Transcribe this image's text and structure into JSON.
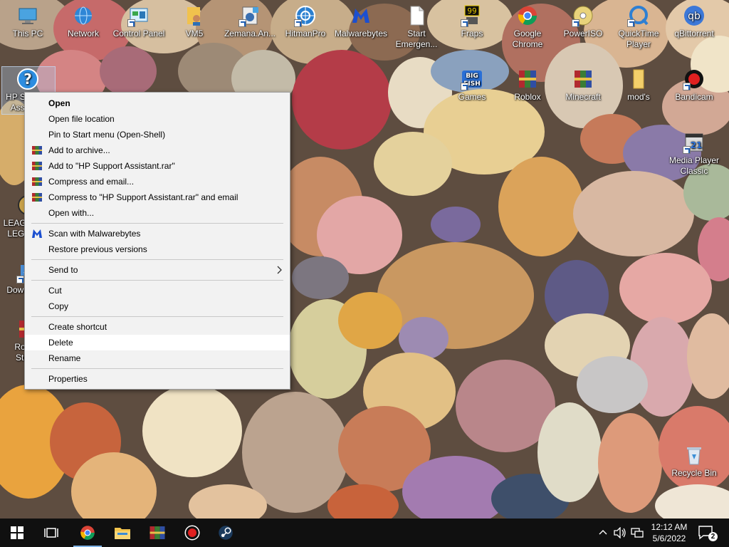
{
  "desktop": {
    "icons": [
      {
        "label": "This PC"
      },
      {
        "label": "Network"
      },
      {
        "label": "Control Panel"
      },
      {
        "label": "VM5"
      },
      {
        "label": "Zemana.An..."
      },
      {
        "label": "HitmanPro"
      },
      {
        "label": "Malwarebytes"
      },
      {
        "label": "Start Emergen..."
      },
      {
        "label": "Fraps"
      },
      {
        "label": "Google Chrome"
      },
      {
        "label": "PowerISO"
      },
      {
        "label": "QuickTime Player"
      },
      {
        "label": "qBittorrent"
      },
      {
        "label": "HP Support Assistant"
      },
      {
        "label": "Games"
      },
      {
        "label": "Roblox"
      },
      {
        "label": "Minecraft"
      },
      {
        "label": "mod's"
      },
      {
        "label": "Bandicam"
      },
      {
        "label": "Media Player Classic"
      },
      {
        "label": "LEAGUE OF LEGENDS"
      },
      {
        "label": "Downloads"
      },
      {
        "label": "Roblox Studio"
      },
      {
        "label": "Recycle Bin"
      }
    ],
    "fraps_badge": "99"
  },
  "context_menu": {
    "items": [
      {
        "label": "Open"
      },
      {
        "label": "Open file location"
      },
      {
        "label": "Pin to Start menu (Open-Shell)"
      },
      {
        "label": "Add to archive..."
      },
      {
        "label": "Add to \"HP Support Assistant.rar\""
      },
      {
        "label": "Compress and email..."
      },
      {
        "label": "Compress to \"HP Support Assistant.rar\" and email"
      },
      {
        "label": "Open with..."
      },
      {
        "label": "Scan with Malwarebytes"
      },
      {
        "label": "Restore previous versions"
      },
      {
        "label": "Send to"
      },
      {
        "label": "Cut"
      },
      {
        "label": "Copy"
      },
      {
        "label": "Create shortcut"
      },
      {
        "label": "Delete"
      },
      {
        "label": "Rename"
      },
      {
        "label": "Properties"
      }
    ],
    "submenu_arrow": ">"
  },
  "taskbar": {
    "clock_time": "12:12 AM",
    "clock_date": "5/6/2022",
    "notification_count": "2",
    "tray_chevron": "^"
  },
  "colors": {
    "taskbar": "#101010",
    "menu_bg": "#f2f2f2",
    "menu_hover": "#ffffff",
    "accent": "#7fb2e5"
  }
}
